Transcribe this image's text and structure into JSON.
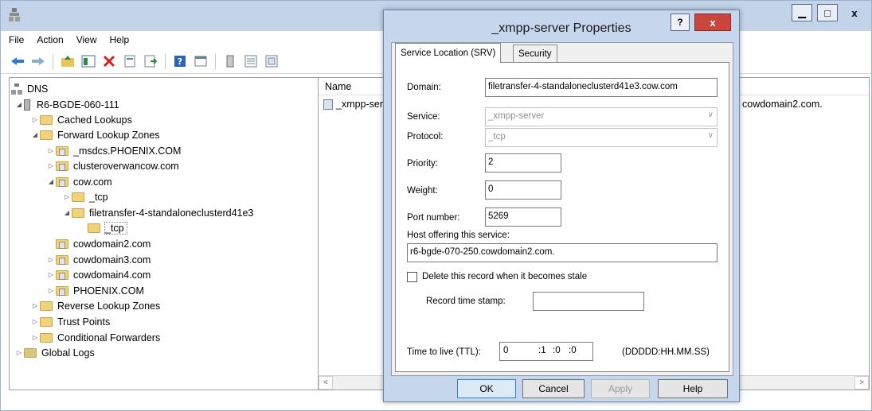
{
  "menu": [
    "File",
    "Action",
    "View",
    "Help"
  ],
  "tree": {
    "root": "DNS",
    "server": "R6-BGDE-060-111",
    "cached": "Cached Lookups",
    "forward": "Forward Lookup Zones",
    "msdcs": "_msdcs.PHOENIX.COM",
    "cluster": "clusteroverwancow.com",
    "cow": "cow.com",
    "tcp1": "_tcp",
    "filetransfer": "filetransfer-4-standaloneclusterd41e3",
    "tcp2": "_tcp",
    "cowdomain2": "cowdomain2.com",
    "cowdomain3": "cowdomain3.com",
    "cowdomain4": "cowdomain4.com",
    "phoenix": "PHOENIX.COM",
    "reverse": "Reverse Lookup Zones",
    "trust": "Trust Points",
    "conditional": "Conditional Forwarders",
    "global": "Global Logs"
  },
  "list": {
    "col_name": "Name",
    "row_name": "_xmpp-ser",
    "row_data": "cowdomain2.com."
  },
  "dialog": {
    "title": "_xmpp-server Properties",
    "help_glyph": "?",
    "close_glyph": "x",
    "tabs": [
      "Service Location (SRV)",
      "Security"
    ],
    "domain_label": "Domain:",
    "domain_value": "filetransfer-4-standaloneclusterd41e3.cow.com",
    "service_label": "Service:",
    "service_value": "_xmpp-server",
    "protocol_label": "Protocol:",
    "protocol_value": "_tcp",
    "priority_label": "Priority:",
    "priority_value": "2",
    "weight_label": "Weight:",
    "weight_value": "0",
    "port_label": "Port number:",
    "port_value": "5269",
    "host_label": "Host offering this service:",
    "host_value": "r6-bgde-070-250.cowdomain2.com.",
    "stale_label": "Delete this record when it becomes stale",
    "timestamp_label": "Record time stamp:",
    "ttl_label": "Time to live (TTL):",
    "ttl_days": "0",
    "ttl_hours": ":1",
    "ttl_minutes": ":0",
    "ttl_seconds": ":0",
    "ttl_format": "(DDDDD:HH.MM.SS)",
    "ok": "OK",
    "cancel": "Cancel",
    "apply": "Apply",
    "help": "Help"
  }
}
